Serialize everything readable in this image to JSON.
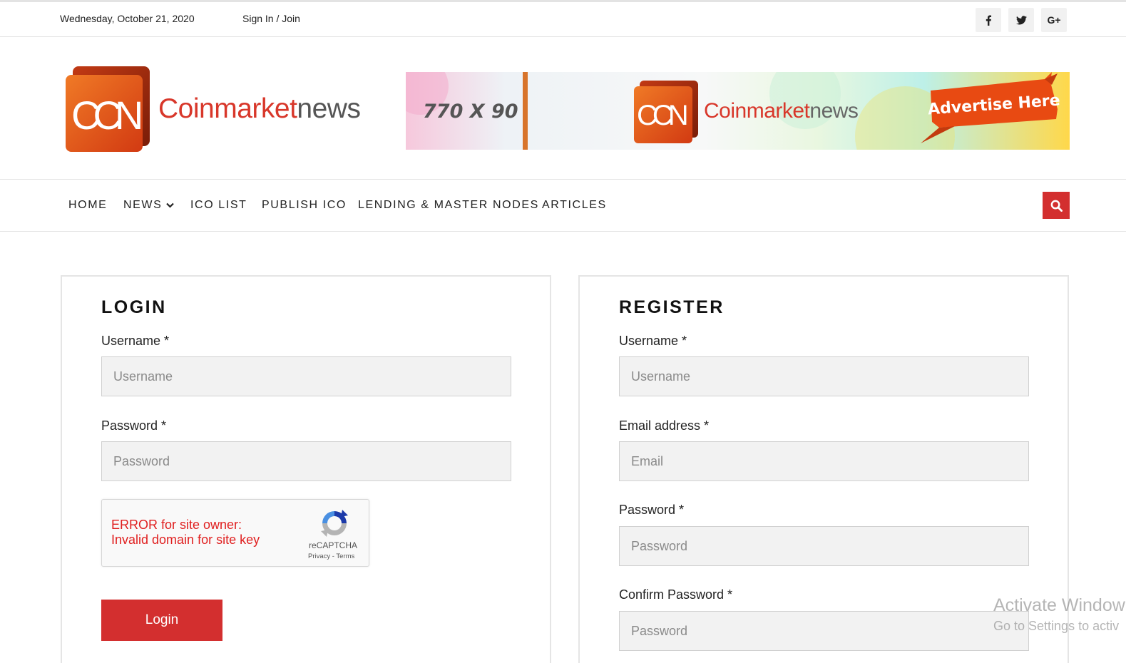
{
  "topbar": {
    "date": "Wednesday, October 21, 2020",
    "signin": "Sign In / Join",
    "social": [
      {
        "icon": "facebook-icon",
        "label": "f"
      },
      {
        "icon": "twitter-icon",
        "label": ""
      },
      {
        "icon": "google-plus-icon",
        "label": "G+"
      }
    ]
  },
  "logo": {
    "part1": "Coinmarket",
    "part2": "news"
  },
  "banner": {
    "size": "770 X 90",
    "logo_part1": "Coinmarket",
    "logo_part2": "news",
    "cta": "Advertise Here"
  },
  "nav": {
    "items": [
      "HOME",
      "NEWS",
      "ICO LIST",
      "PUBLISH ICO",
      "LENDING & MASTER NODES",
      "ARTICLES"
    ],
    "search_icon": "search-icon"
  },
  "login": {
    "title": "LOGIN",
    "username_label": "Username *",
    "username_placeholder": "Username",
    "password_label": "Password *",
    "password_placeholder": "Password",
    "captcha_error_line1": "ERROR for site owner:",
    "captcha_error_line2": "Invalid domain for site key",
    "captcha_brand": "reCAPTCHA",
    "captcha_links": "Privacy - Terms",
    "button": "Login"
  },
  "register": {
    "title": "REGISTER",
    "username_label": "Username *",
    "username_placeholder": "Username",
    "email_label": "Email address *",
    "email_placeholder": "Email",
    "password_label": "Password *",
    "password_placeholder": "Password",
    "confirm_label": "Confirm Password *",
    "confirm_placeholder": "Password"
  },
  "watermark": {
    "line1": "Activate Window",
    "line2": "Go to Settings to activ"
  },
  "colors": {
    "accent": "#d32f2f",
    "logo_red": "#d8372a",
    "logo_orange": "#e8641c"
  }
}
